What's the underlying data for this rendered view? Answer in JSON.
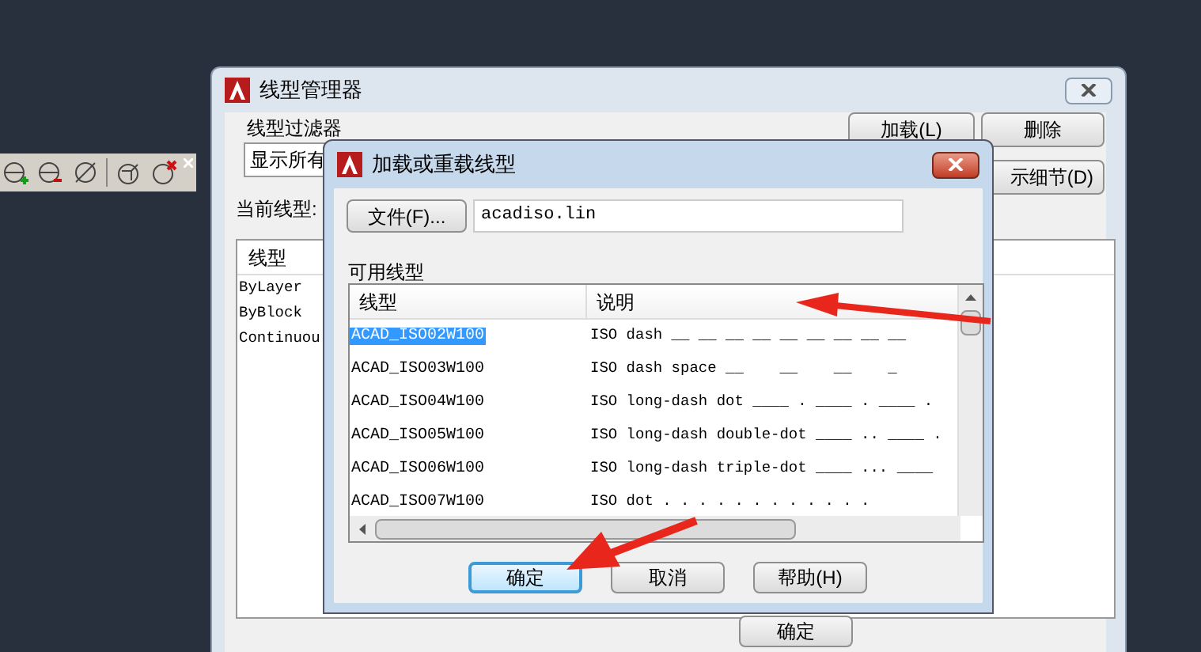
{
  "linetype_manager": {
    "title": "线型管理器",
    "filter_label": "线型过滤器",
    "filter_value": "显示所有",
    "buttons": [
      {
        "label": "加载(L)"
      },
      {
        "label": "删除"
      },
      {
        "label": "示细节(D)"
      }
    ],
    "current_label": "当前线型:",
    "list_header": "线型",
    "list_items": [
      "ByLayer",
      "ByBlock",
      "Continuou"
    ],
    "ok_button": "确定"
  },
  "load_dialog": {
    "title": "加载或重载线型",
    "file_button": "文件(F)...",
    "file_value": "acadiso.lin",
    "available_label": "可用线型",
    "columns": [
      "线型",
      "说明"
    ],
    "rows": [
      {
        "name": "ACAD_ISO02W100",
        "description": "ISO dash __ __ __ __ __ __ __ __ __",
        "selected": true
      },
      {
        "name": "ACAD_ISO03W100",
        "description": "ISO dash space __    __    __    _",
        "selected": false
      },
      {
        "name": "ACAD_ISO04W100",
        "description": "ISO long-dash dot ____ . ____ . ____ .",
        "selected": false
      },
      {
        "name": "ACAD_ISO05W100",
        "description": "ISO long-dash double-dot ____ .. ____ .",
        "selected": false
      },
      {
        "name": "ACAD_ISO06W100",
        "description": "ISO long-dash triple-dot ____ ... ____",
        "selected": false
      },
      {
        "name": "ACAD_ISO07W100",
        "description": "ISO dot . . . . . . . . . . . .",
        "selected": false
      }
    ],
    "buttons": [
      {
        "label": "确定",
        "default": true
      },
      {
        "label": "取消",
        "default": false
      },
      {
        "label": "帮助(H)",
        "default": false
      }
    ]
  }
}
